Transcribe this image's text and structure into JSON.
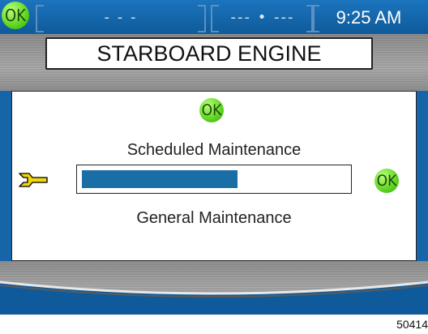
{
  "status_bar": {
    "ok_label": "OK",
    "field_1": "- - -",
    "field_2": "--- • ---",
    "time": "9:25 AM"
  },
  "title": "STARBOARD ENGINE",
  "panel": {
    "ok_top": "OK",
    "ok_right": "OK",
    "scheduled_label": "Scheduled Maintenance",
    "general_label": "General Maintenance",
    "progress_fraction": 0.59,
    "wrench_icon": "wrench-icon"
  },
  "figure_id": "50414",
  "colors": {
    "screen_blue": "#1565a8",
    "progress_fill": "#1a6ea6",
    "ok_green": "#5fd420",
    "wrench_yellow": "#f5d800"
  }
}
